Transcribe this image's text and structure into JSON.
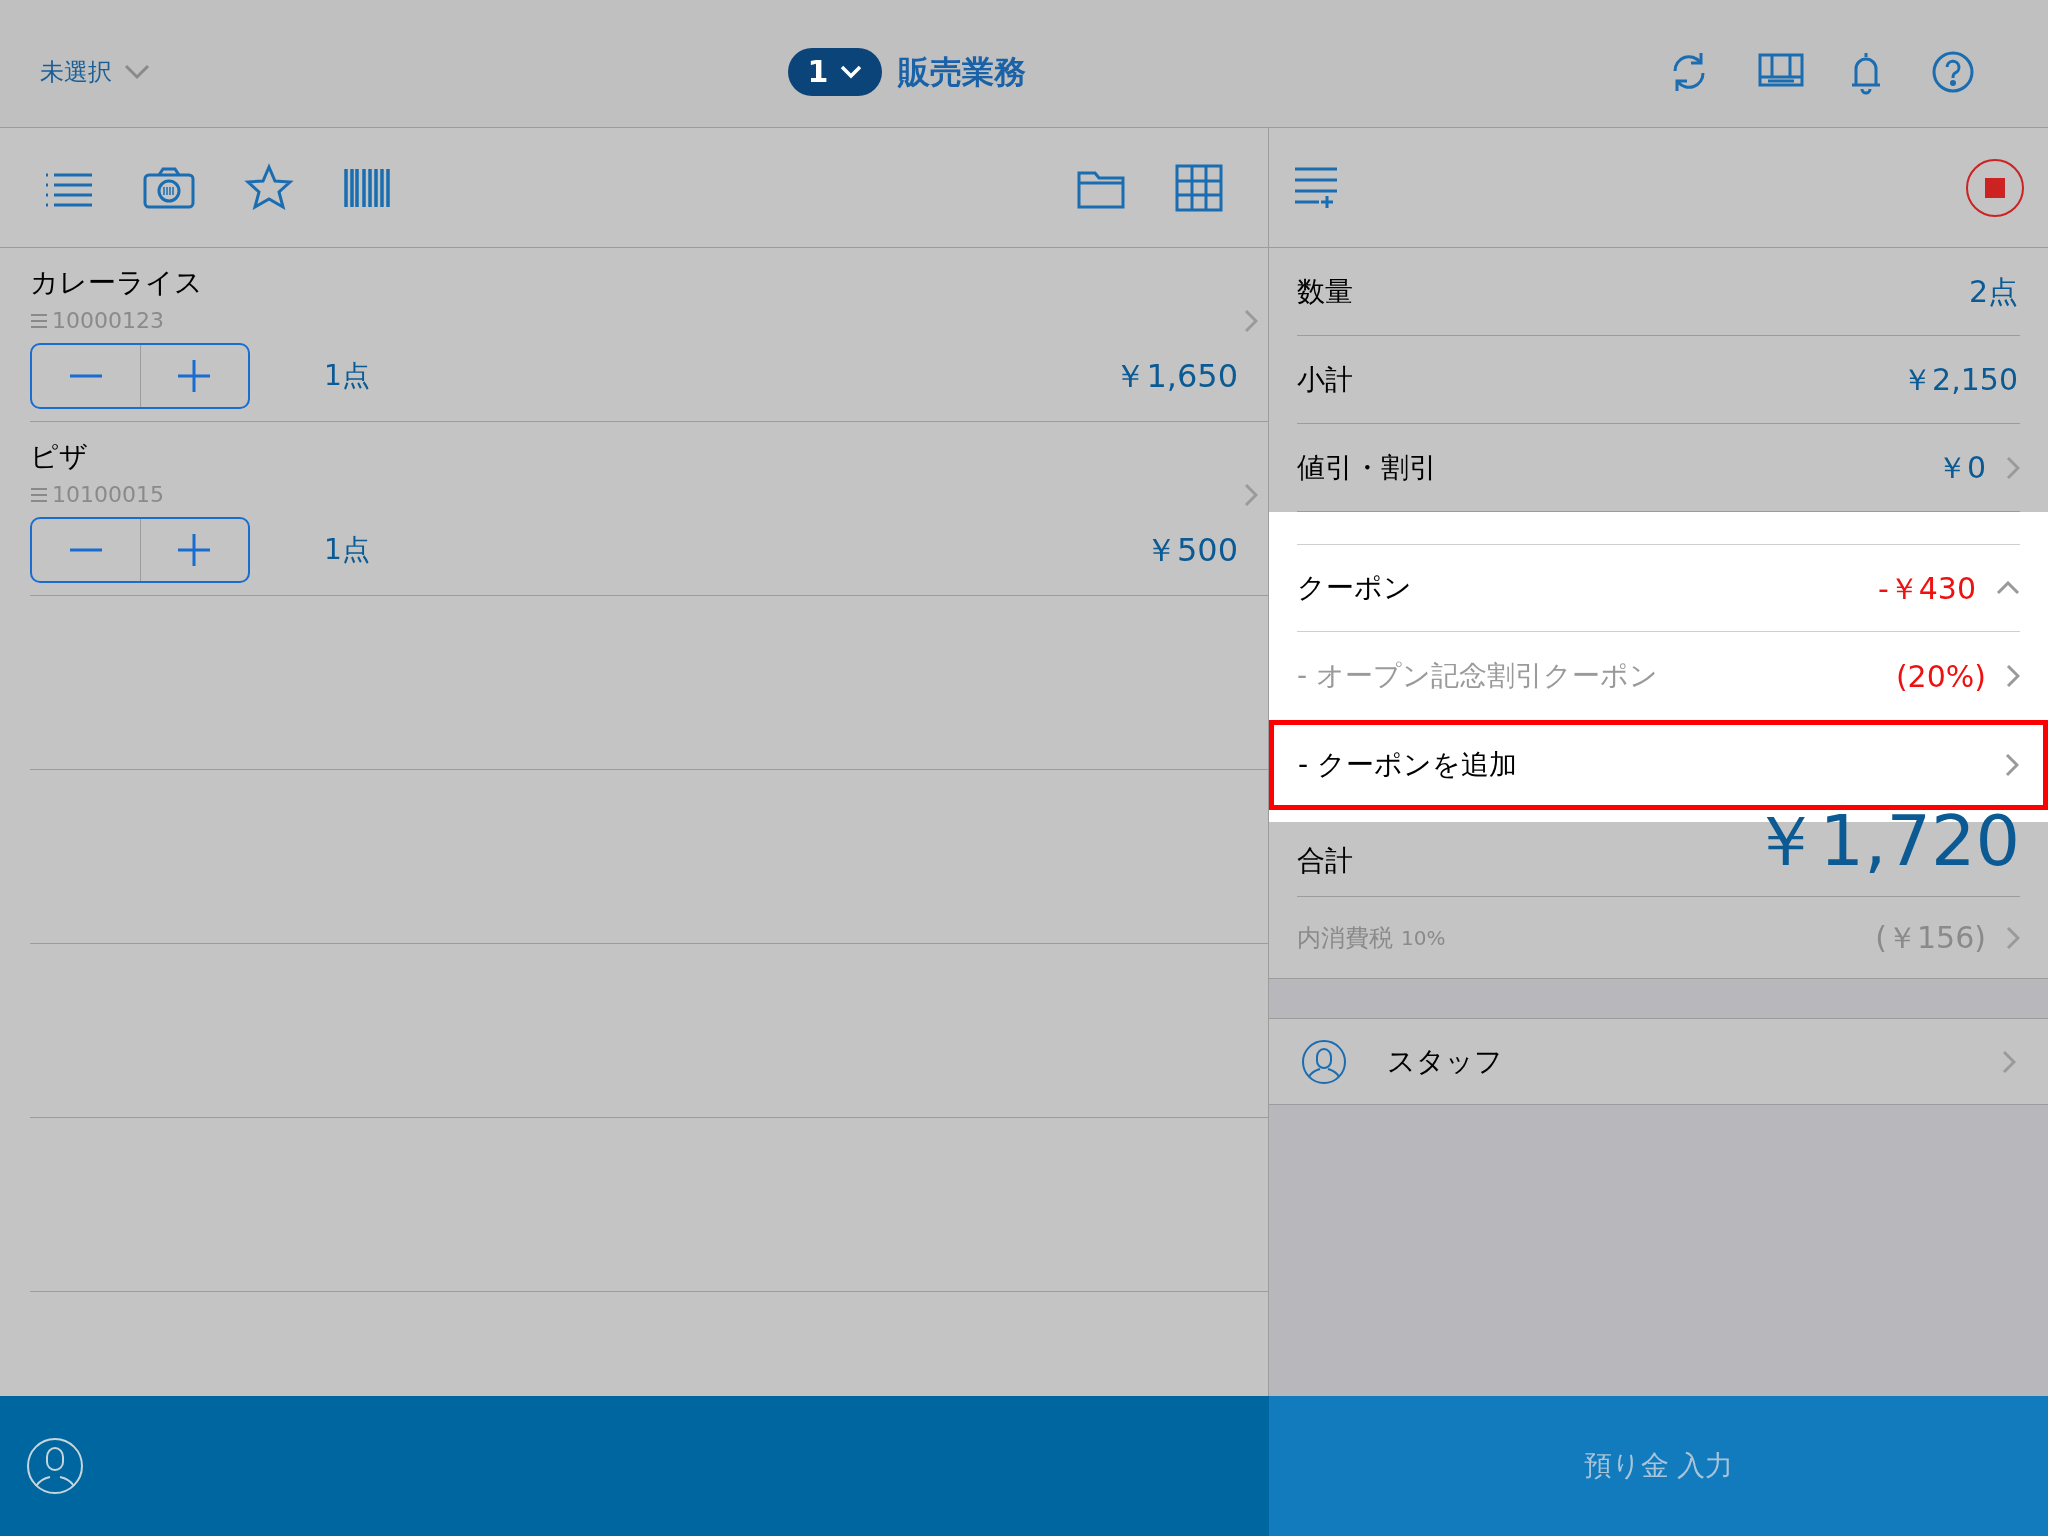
{
  "header": {
    "selector": "未選択",
    "register_number": "1",
    "title": "販売業務"
  },
  "items": [
    {
      "name": "カレーライス",
      "code": "10000123",
      "quantity": "1点",
      "price": "￥1,650"
    },
    {
      "name": "ピザ",
      "code": "10100015",
      "quantity": "1点",
      "price": "￥500"
    }
  ],
  "summary": [
    {
      "kind": "value",
      "label": "数量",
      "value": "2点",
      "chevron": false
    },
    {
      "kind": "value",
      "label": "小計",
      "value": "￥2,150",
      "chevron": false
    },
    {
      "kind": "value",
      "label": "値引・割引",
      "value": "￥0",
      "chevron": true
    },
    {
      "kind": "coupon",
      "label": "クーポン",
      "value": "-￥430",
      "expanded": true
    },
    {
      "kind": "coupon_item",
      "label": "- オープン記念割引クーポン",
      "value": "(20%)"
    },
    {
      "kind": "add",
      "label": "- クーポンを追加",
      "highlighted": true
    },
    {
      "kind": "total",
      "label": "合計",
      "value": "￥1,720"
    },
    {
      "kind": "tax",
      "label": "内消費税",
      "rate": "10%",
      "value": "(￥156)"
    }
  ],
  "staff": {
    "label": "スタッフ"
  },
  "deposit_button": "預り金 入力"
}
